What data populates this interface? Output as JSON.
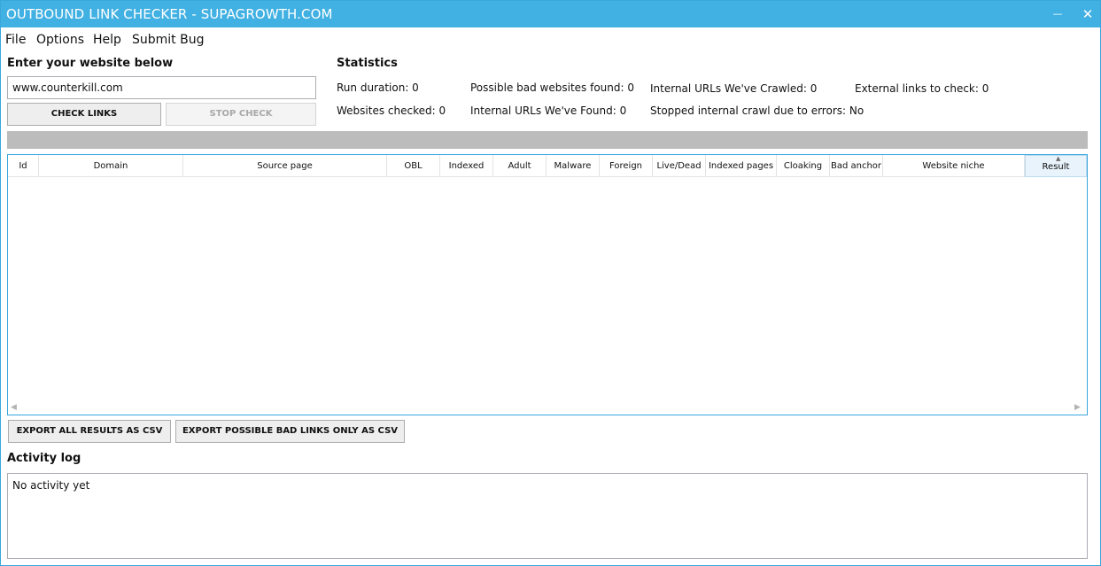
{
  "window": {
    "title": "OUTBOUND LINK CHECKER - SUPAGROWTH.COM",
    "minimize_glyph": "—",
    "close_glyph": "✕"
  },
  "menu": [
    "File",
    "Options",
    "Help",
    "Submit Bug"
  ],
  "input_section": {
    "label": "Enter your website below",
    "url_value": "www.counterkill.com",
    "check_button": "CHECK LINKS",
    "stop_button": "STOP CHECK"
  },
  "statistics": {
    "label": "Statistics",
    "items": [
      "Run duration: 0",
      "Possible bad websites found: 0",
      "Internal URLs We've Crawled: 0",
      "External links to check: 0",
      "Websites checked: 0",
      "Internal URLs We've Found: 0",
      "Stopped internal crawl due to errors: No"
    ]
  },
  "progress": {
    "value": 0
  },
  "table": {
    "columns": [
      "Id",
      "Domain",
      "Source page",
      "OBL",
      "Indexed",
      "Adult",
      "Malware",
      "Foreign",
      "Live/Dead",
      "Indexed pages",
      "Cloaking",
      "Bad anchor",
      "Website niche",
      "Result"
    ],
    "sorted_column": "Result",
    "sort_glyph": "▲",
    "scroll_left_glyph": "◀",
    "scroll_right_glyph": "▶",
    "rows": []
  },
  "export": {
    "all_button": "EXPORT ALL RESULTS AS CSV",
    "bad_button": "EXPORT POSSIBLE BAD LINKS ONLY AS CSV"
  },
  "activity_log": {
    "label": "Activity log",
    "text": "No activity yet"
  },
  "colors": {
    "titlebar": "#41b0e2",
    "accent_border": "#3aa6dc",
    "progress_track": "#bcbcbc"
  }
}
